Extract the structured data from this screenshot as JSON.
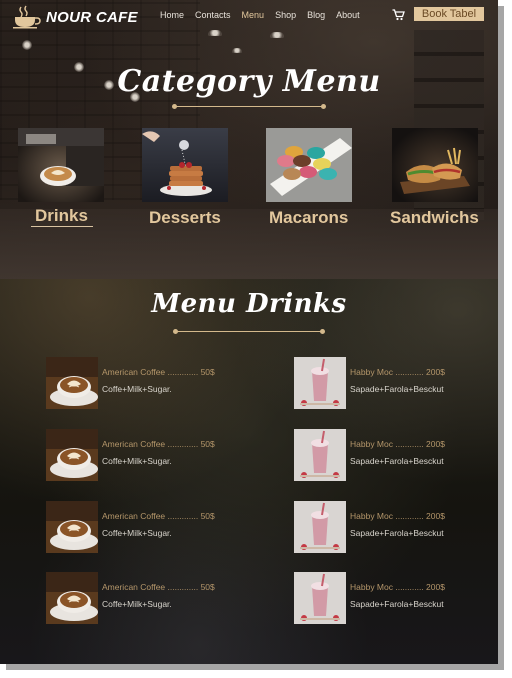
{
  "brand": {
    "name": "NOUR CAFE",
    "icon": "coffee-cup-icon"
  },
  "nav": {
    "links": [
      "Home",
      "Contacts",
      "Menu",
      "Shop",
      "Blog",
      "About"
    ],
    "active": "Menu",
    "cart_icon": "cart-icon",
    "book_label": "Book Tabel"
  },
  "hero": {
    "title": "Category Menu",
    "categories": [
      {
        "label": "Drinks"
      },
      {
        "label": "Desserts"
      },
      {
        "label": "Macarons"
      },
      {
        "label": "Sandwichs"
      }
    ]
  },
  "menu": {
    "title": "Menu Drinks",
    "left_items": [
      {
        "name": "American Coffee ............. 50$",
        "desc": "Coffe+Milk+Sugar."
      },
      {
        "name": "American Coffee ............. 50$",
        "desc": "Coffe+Milk+Sugar."
      },
      {
        "name": "American Coffee ............. 50$",
        "desc": "Coffe+Milk+Sugar."
      },
      {
        "name": "American Coffee ............. 50$",
        "desc": "Coffe+Milk+Sugar."
      }
    ],
    "right_items": [
      {
        "name": "Habby Moc  ............ 200$",
        "desc": "Sapade+Farola+Besckut"
      },
      {
        "name": "Habby Moc  ............ 200$",
        "desc": "Sapade+Farola+Besckut"
      },
      {
        "name": "Habby Moc  ............ 200$",
        "desc": "Sapade+Farola+Besckut"
      },
      {
        "name": "Habby Moc  ............ 200$",
        "desc": "Sapade+Farola+Besckut"
      }
    ]
  },
  "colors": {
    "accent": "#e2c79d",
    "price_text": "#b4966a",
    "background": "#1a1512"
  }
}
